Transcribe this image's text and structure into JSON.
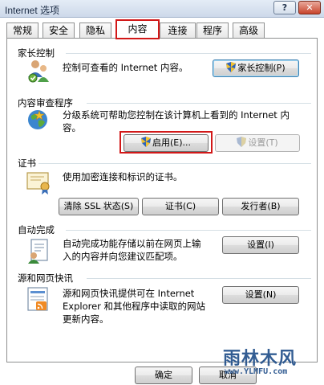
{
  "window": {
    "title": "Internet 选项",
    "help_label": "?",
    "close_label": "✕"
  },
  "tabs": [
    {
      "label": "常规"
    },
    {
      "label": "安全"
    },
    {
      "label": "隐私"
    },
    {
      "label": "内容",
      "active": true
    },
    {
      "label": "连接"
    },
    {
      "label": "程序"
    },
    {
      "label": "高级"
    }
  ],
  "parental": {
    "heading": "家长控制",
    "description": "控制可查看的 Internet 内容。",
    "button": "家长控制(P)"
  },
  "advisor": {
    "heading": "内容审查程序",
    "description_line1": "分级系统可帮助您控制在该计算机上看到的 Internet 内",
    "description_line2": "容。",
    "enable_button": "启用(E)...",
    "settings_button": "设置(T)"
  },
  "certificates": {
    "heading": "证书",
    "description": "使用加密连接和标识的证书。",
    "clear_ssl_button": "清除 SSL 状态(S)",
    "certificates_button": "证书(C)",
    "publishers_button": "发行者(B)"
  },
  "autocomplete": {
    "heading": "自动完成",
    "description_line1": "自动完成功能存储以前在网页上输",
    "description_line2": "入的内容并向您建议匹配项。",
    "settings_button": "设置(I)"
  },
  "feeds": {
    "heading": "源和网页快讯",
    "description_line1": "源和网页快讯提供可在 Internet",
    "description_line2": "Explorer 和其他程序中读取的网站",
    "description_line3": "更新内容。",
    "settings_button": "设置(N)"
  },
  "footer": {
    "ok_button": "确定",
    "cancel_button": "取消"
  },
  "watermark": {
    "title": "雨林木风",
    "url": "www.YLMFU.com"
  },
  "colors": {
    "highlight_red": "#d21818",
    "titlebar": "#cdd9ea"
  }
}
